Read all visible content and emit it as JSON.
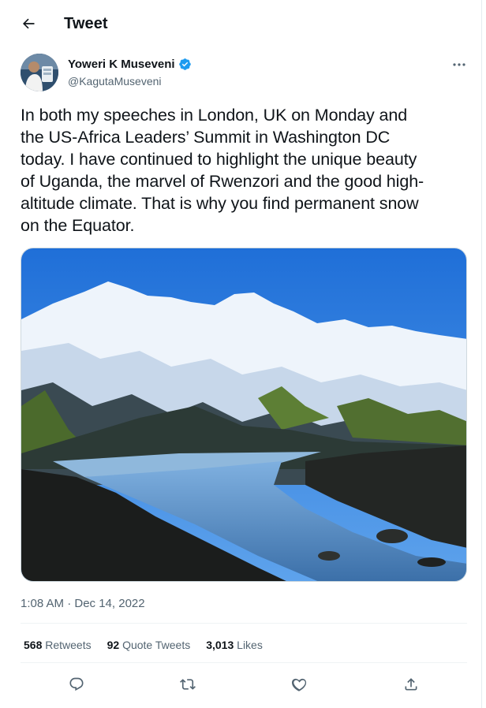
{
  "header": {
    "title": "Tweet",
    "back_icon": "arrow-left-icon"
  },
  "author": {
    "display_name": "Yoweri K Museveni",
    "handle": "@KagutaMuseveni",
    "verified": true,
    "more_icon": "ellipsis-icon"
  },
  "tweet": {
    "text": "In both my speeches in London, UK on Monday and\nthe US-Africa Leaders’ Summit in Washington DC\ntoday. I have continued to highlight the unique beauty\nof Uganda, the marvel of Rwenzori and the good high-\naltitude climate. That is why you find permanent snow\non the Equator.",
    "timestamp": "1:08 AM · Dec 14, 2022"
  },
  "stats": {
    "retweets_count": "568",
    "retweets_label": "Retweets",
    "quotes_count": "92",
    "quotes_label": "Quote Tweets",
    "likes_count": "3,013",
    "likes_label": "Likes"
  },
  "actions": [
    "reply-icon",
    "retweet-icon",
    "like-icon",
    "share-icon"
  ],
  "colors": {
    "verified": "#1d9bf0",
    "text": "#0f1419",
    "secondary": "#536471",
    "divider": "#eff3f4"
  }
}
